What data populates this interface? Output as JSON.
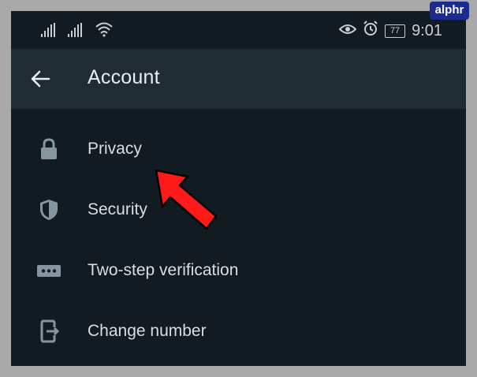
{
  "status_bar": {
    "time": "9:01",
    "battery": "77"
  },
  "app_bar": {
    "title": "Account"
  },
  "menu": [
    {
      "label": "Privacy",
      "icon": "lock-icon"
    },
    {
      "label": "Security",
      "icon": "shield-icon"
    },
    {
      "label": "Two-step verification",
      "icon": "password-dots-icon"
    },
    {
      "label": "Change number",
      "icon": "change-number-icon"
    }
  ],
  "watermark": "alphr",
  "colors": {
    "background": "#121b22",
    "app_bar": "#1f2c34",
    "text": "#d9dee0",
    "icon": "#8696a0",
    "arrow": "#ff1a1a"
  }
}
